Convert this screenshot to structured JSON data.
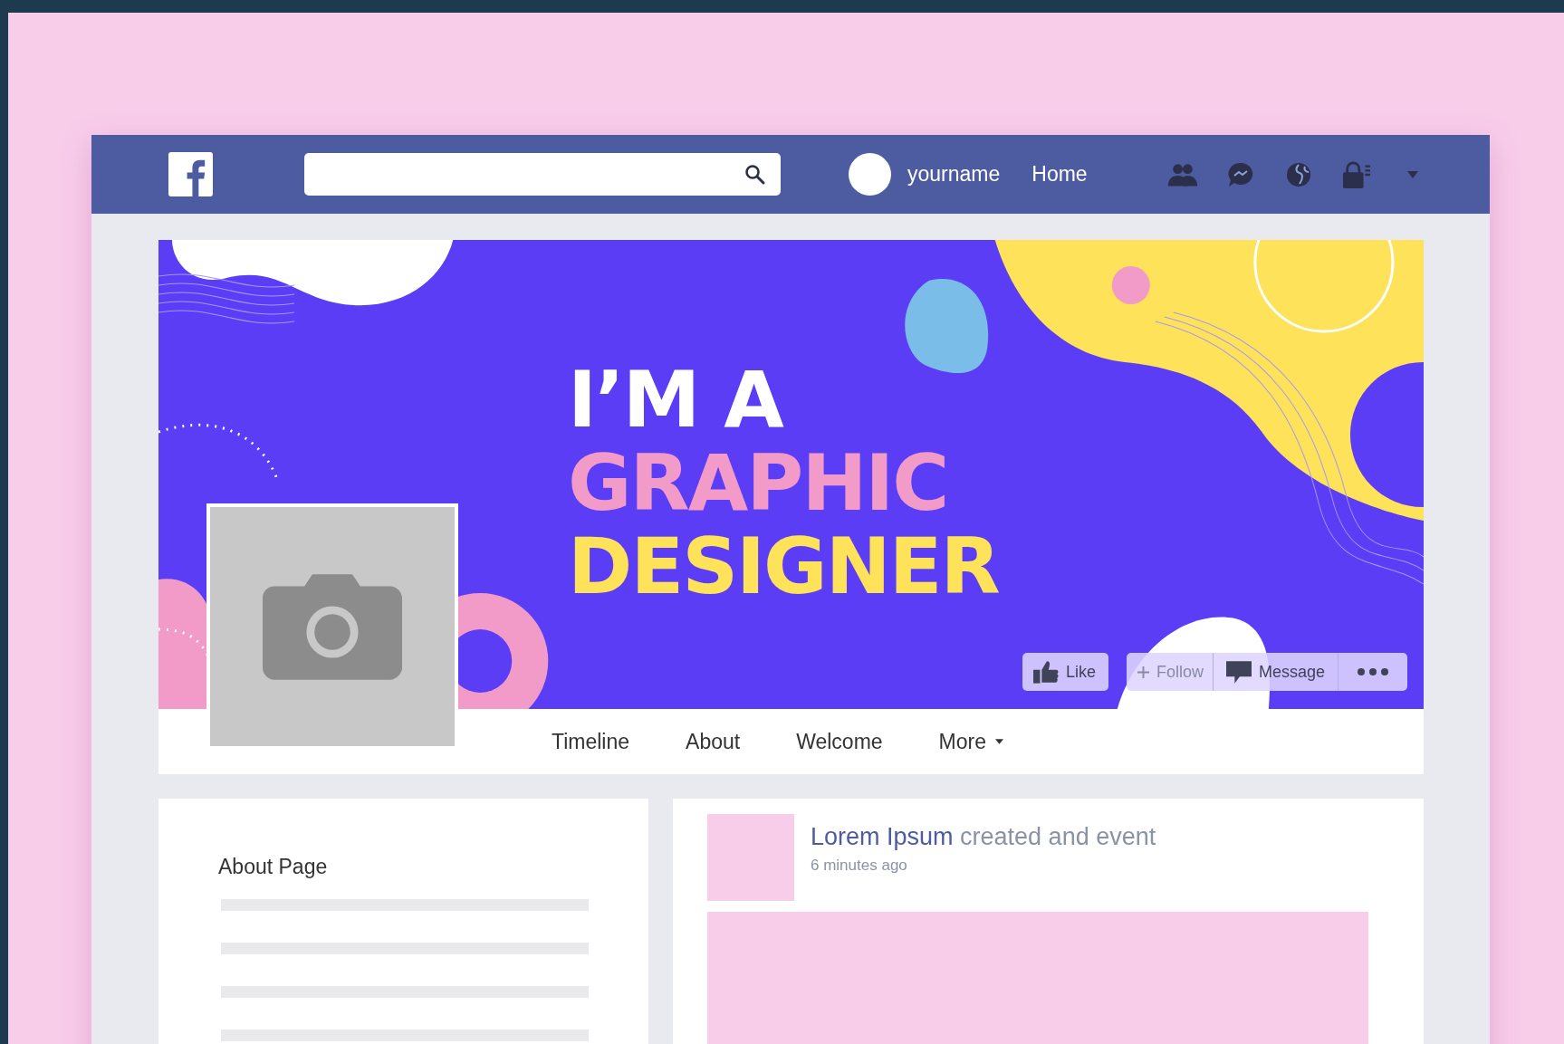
{
  "header": {
    "user_name": "yourname",
    "home_link": "Home"
  },
  "cover": {
    "headline": [
      {
        "text": "I’M A",
        "color": "#ffffff"
      },
      {
        "text": "GRAPHIC",
        "color": "#f29ac8"
      },
      {
        "text": "DESIGNER",
        "color": "#fde25a"
      }
    ],
    "actions": [
      {
        "kind": "like",
        "label": "Like"
      },
      {
        "kind": "follow",
        "label": "Follow"
      },
      {
        "kind": "message",
        "label": "Message"
      },
      {
        "kind": "more"
      }
    ]
  },
  "tabs": [
    {
      "label": "Timeline",
      "selected": false,
      "dropdown": false
    },
    {
      "label": "About",
      "selected": false,
      "dropdown": false
    },
    {
      "label": "Welcome",
      "selected": false,
      "dropdown": false
    },
    {
      "label": "More",
      "selected": false,
      "dropdown": true
    }
  ],
  "about_card": {
    "title": "About Page"
  },
  "post": {
    "author": "Lorem Ipsum",
    "action": "created and event",
    "time": "6 minutes ago"
  }
}
